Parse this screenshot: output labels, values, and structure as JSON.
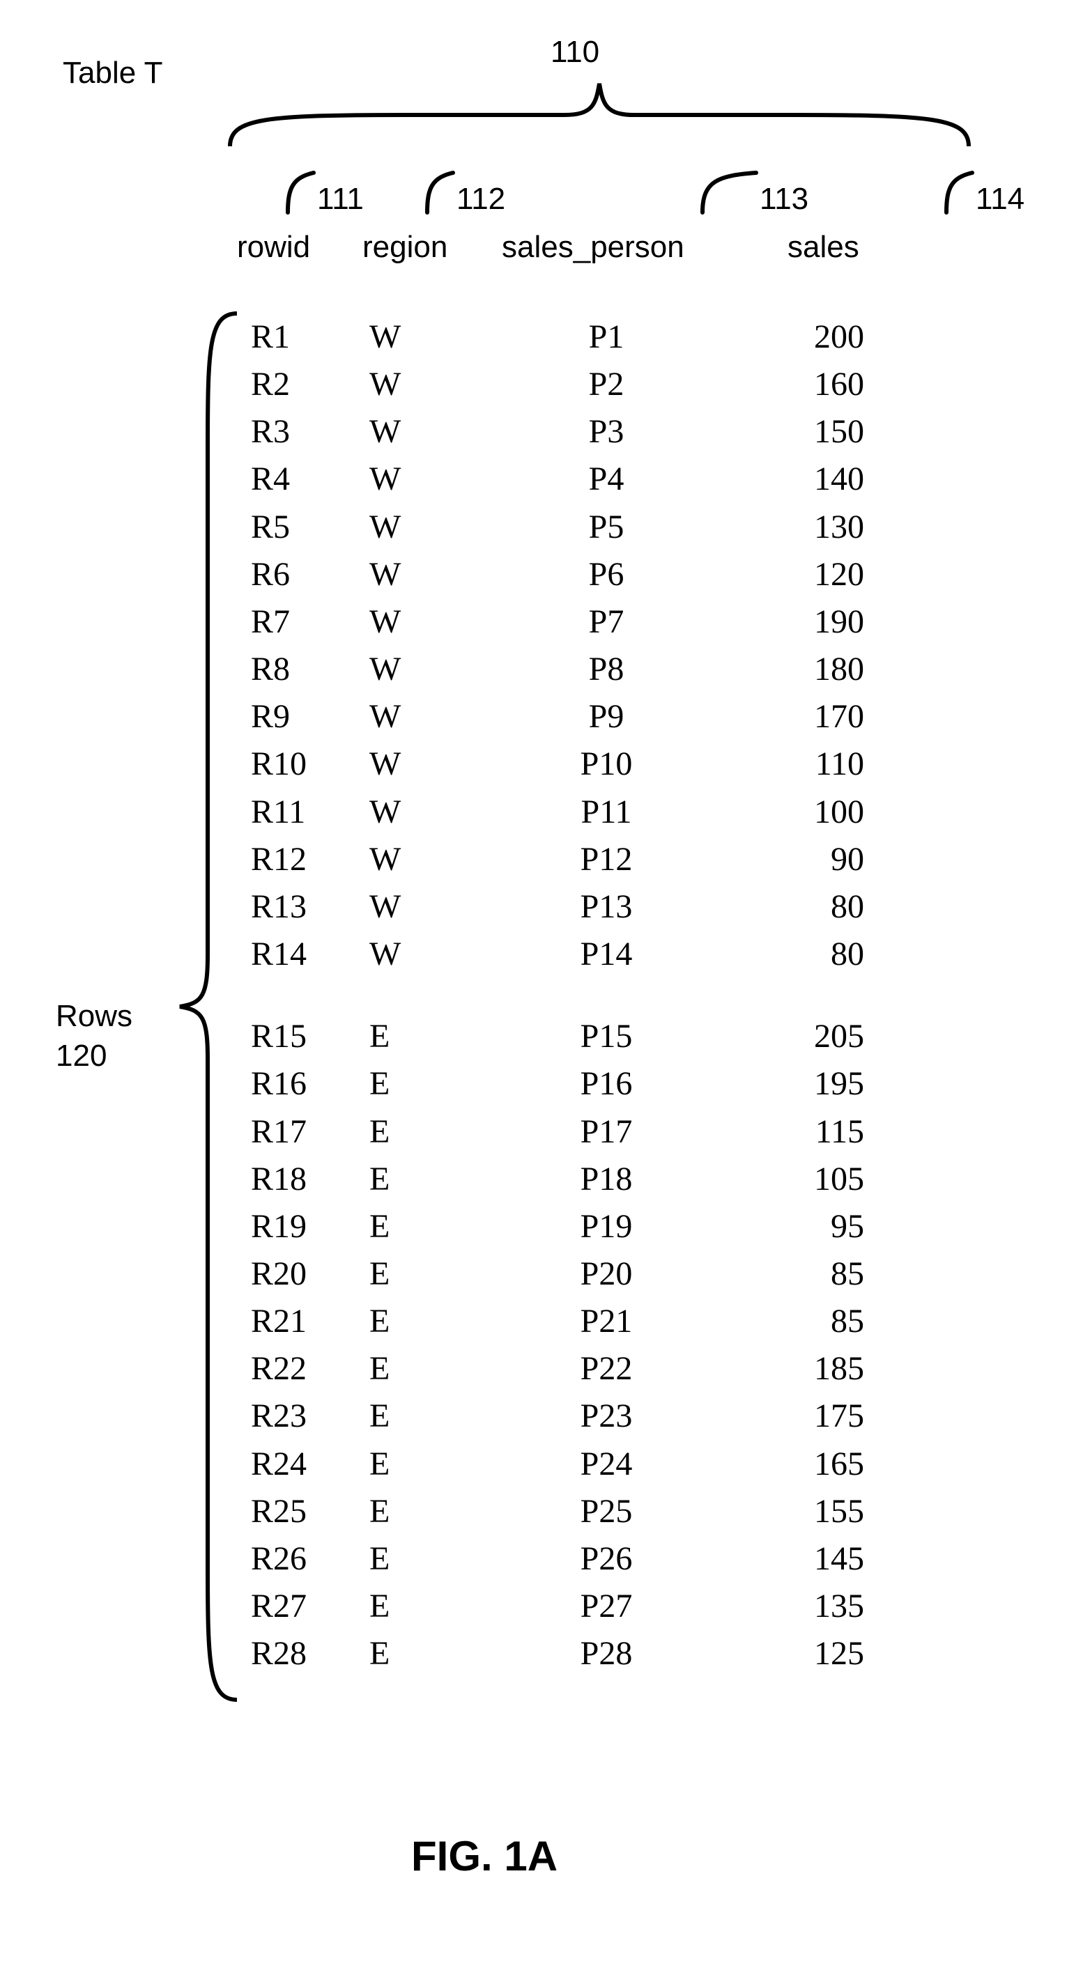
{
  "labels": {
    "table": "Table T",
    "rows_label_1": "Rows",
    "rows_label_2": "120",
    "figure": "FIG. 1A",
    "ref_header": "110",
    "col_refs": {
      "c1": "111",
      "c2": "112",
      "c3": "113",
      "c4": "114"
    },
    "headers": {
      "c1": "rowid",
      "c2": "region",
      "c3": "sales_person",
      "c4": "sales"
    }
  },
  "rows": [
    {
      "rowid": "R1",
      "region": "W",
      "sales_person": "P1",
      "sales": 200
    },
    {
      "rowid": "R2",
      "region": "W",
      "sales_person": "P2",
      "sales": 160
    },
    {
      "rowid": "R3",
      "region": "W",
      "sales_person": "P3",
      "sales": 150
    },
    {
      "rowid": "R4",
      "region": "W",
      "sales_person": "P4",
      "sales": 140
    },
    {
      "rowid": "R5",
      "region": "W",
      "sales_person": "P5",
      "sales": 130
    },
    {
      "rowid": "R6",
      "region": "W",
      "sales_person": "P6",
      "sales": 120
    },
    {
      "rowid": "R7",
      "region": "W",
      "sales_person": "P7",
      "sales": 190
    },
    {
      "rowid": "R8",
      "region": "W",
      "sales_person": "P8",
      "sales": 180
    },
    {
      "rowid": "R9",
      "region": "W",
      "sales_person": "P9",
      "sales": 170
    },
    {
      "rowid": "R10",
      "region": "W",
      "sales_person": "P10",
      "sales": 110
    },
    {
      "rowid": "R11",
      "region": "W",
      "sales_person": "P11",
      "sales": 100
    },
    {
      "rowid": "R12",
      "region": "W",
      "sales_person": "P12",
      "sales": 90
    },
    {
      "rowid": "R13",
      "region": "W",
      "sales_person": "P13",
      "sales": 80
    },
    {
      "rowid": "R14",
      "region": "W",
      "sales_person": "P14",
      "sales": 80
    },
    {
      "rowid": "R15",
      "region": "E",
      "sales_person": "P15",
      "sales": 205
    },
    {
      "rowid": "R16",
      "region": "E",
      "sales_person": "P16",
      "sales": 195
    },
    {
      "rowid": "R17",
      "region": "E",
      "sales_person": "P17",
      "sales": 115
    },
    {
      "rowid": "R18",
      "region": "E",
      "sales_person": "P18",
      "sales": 105
    },
    {
      "rowid": "R19",
      "region": "E",
      "sales_person": "P19",
      "sales": 95
    },
    {
      "rowid": "R20",
      "region": "E",
      "sales_person": "P20",
      "sales": 85
    },
    {
      "rowid": "R21",
      "region": "E",
      "sales_person": "P21",
      "sales": 85
    },
    {
      "rowid": "R22",
      "region": "E",
      "sales_person": "P22",
      "sales": 185
    },
    {
      "rowid": "R23",
      "region": "E",
      "sales_person": "P23",
      "sales": 175
    },
    {
      "rowid": "R24",
      "region": "E",
      "sales_person": "P24",
      "sales": 165
    },
    {
      "rowid": "R25",
      "region": "E",
      "sales_person": "P25",
      "sales": 155
    },
    {
      "rowid": "R26",
      "region": "E",
      "sales_person": "P26",
      "sales": 145
    },
    {
      "rowid": "R27",
      "region": "E",
      "sales_person": "P27",
      "sales": 135
    },
    {
      "rowid": "R28",
      "region": "E",
      "sales_person": "P28",
      "sales": 125
    }
  ],
  "gap_after_index": 13
}
